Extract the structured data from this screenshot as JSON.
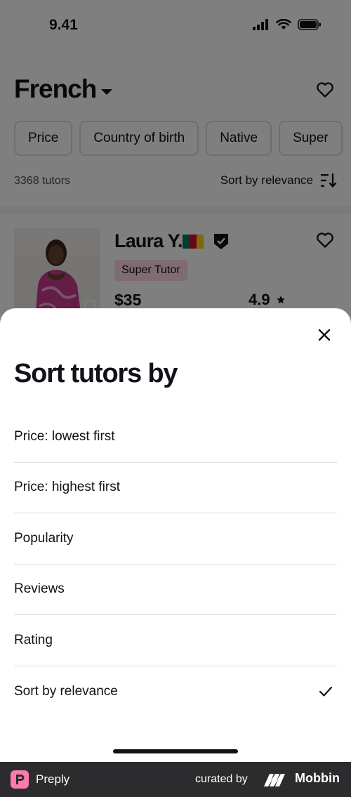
{
  "status_bar": {
    "time": "9.41"
  },
  "header": {
    "language": "French"
  },
  "filters": [
    "Price",
    "Country of birth",
    "Native",
    "Super"
  ],
  "results": {
    "count_text": "3368 tutors",
    "sort_label": "Sort by relevance"
  },
  "tutor": {
    "name": "Laura Y.",
    "badge": "Super Tutor",
    "price": "$35",
    "rating": "4.9",
    "flag_colors": [
      "#007a5e",
      "#ce1126",
      "#fcd116"
    ]
  },
  "sheet": {
    "title": "Sort tutors by",
    "options": [
      {
        "label": "Price: lowest first",
        "selected": false
      },
      {
        "label": "Price: highest first",
        "selected": false
      },
      {
        "label": "Popularity",
        "selected": false
      },
      {
        "label": "Reviews",
        "selected": false
      },
      {
        "label": "Rating",
        "selected": false
      },
      {
        "label": "Sort by relevance",
        "selected": true
      }
    ]
  },
  "footer": {
    "app_name": "Preply",
    "curated_by": "curated by",
    "brand": "Mobbin"
  },
  "colors": {
    "text": "#121117",
    "badge_bg": "#ffd6e8",
    "divider": "#dcdce5",
    "footer_bg": "#2c2c2e",
    "preply_pink": "#ff7aac"
  },
  "icons": [
    "signal-icon",
    "wifi-icon",
    "battery-icon",
    "caret-down-icon",
    "heart-icon",
    "sort-icon",
    "verified-icon",
    "star-icon",
    "close-icon",
    "check-icon"
  ]
}
